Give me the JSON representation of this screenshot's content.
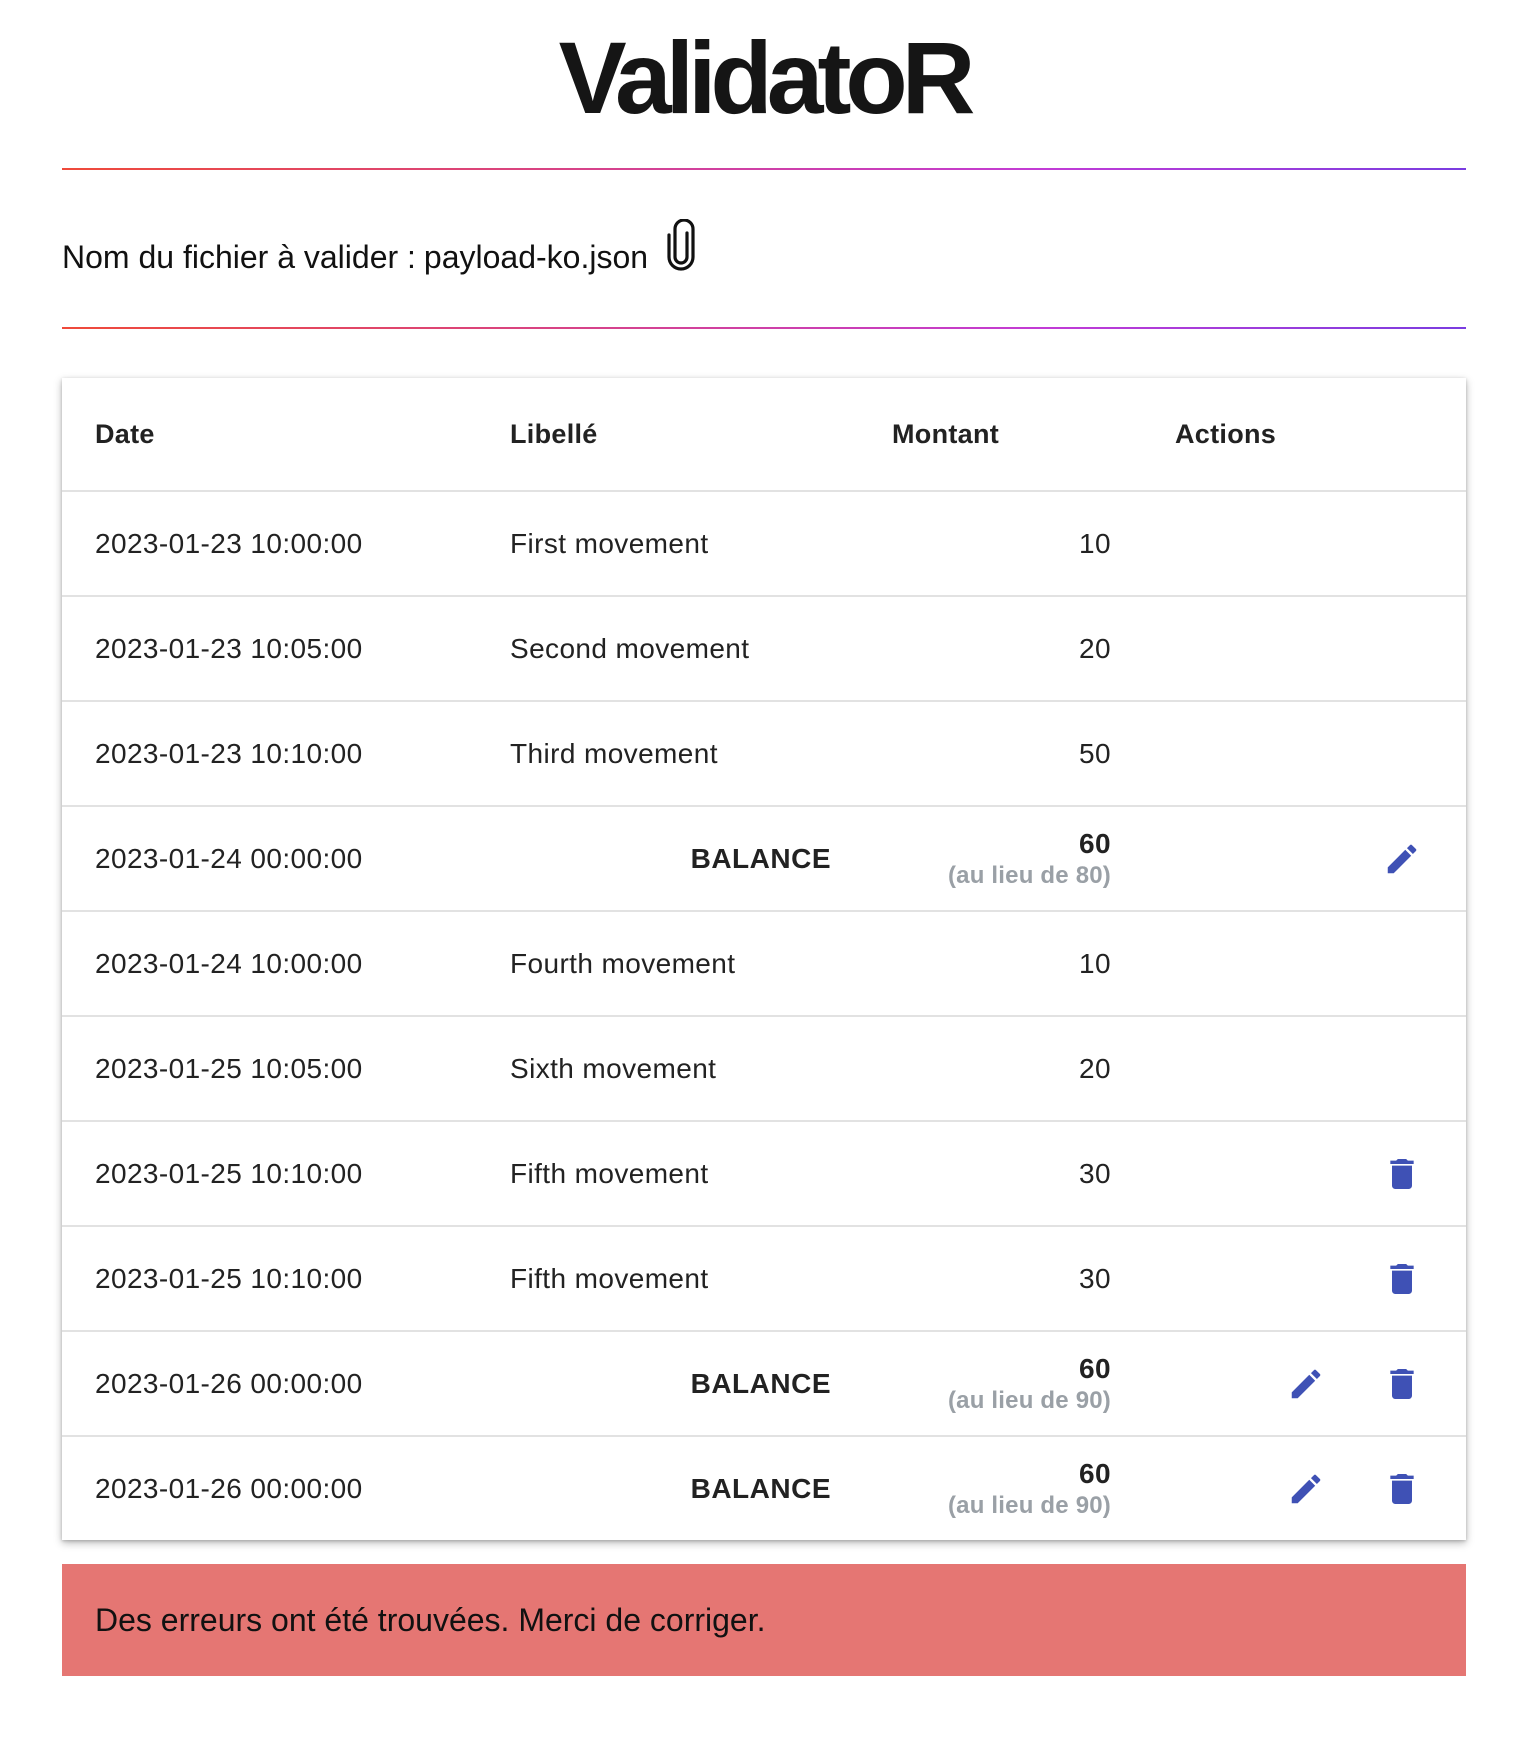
{
  "app": {
    "title": "ValidatoR"
  },
  "file": {
    "label": "Nom du fichier à valider :",
    "name": "payload-ko.json",
    "icon": "paperclip-icon"
  },
  "table": {
    "headers": {
      "date": "Date",
      "label": "Libellé",
      "amount": "Montant",
      "actions": "Actions"
    },
    "rows": [
      {
        "date": "2023-01-23 10:00:00",
        "label": "First movement",
        "amount": "10",
        "sub": "",
        "balance": false,
        "edit": false,
        "delete": false
      },
      {
        "date": "2023-01-23 10:05:00",
        "label": "Second movement",
        "amount": "20",
        "sub": "",
        "balance": false,
        "edit": false,
        "delete": false
      },
      {
        "date": "2023-01-23 10:10:00",
        "label": "Third movement",
        "amount": "50",
        "sub": "",
        "balance": false,
        "edit": false,
        "delete": false
      },
      {
        "date": "2023-01-24 00:00:00",
        "label": "BALANCE",
        "amount": "60",
        "sub": "(au lieu de 80)",
        "balance": true,
        "edit": true,
        "delete": false
      },
      {
        "date": "2023-01-24 10:00:00",
        "label": "Fourth movement",
        "amount": "10",
        "sub": "",
        "balance": false,
        "edit": false,
        "delete": false
      },
      {
        "date": "2023-01-25 10:05:00",
        "label": "Sixth movement",
        "amount": "20",
        "sub": "",
        "balance": false,
        "edit": false,
        "delete": false
      },
      {
        "date": "2023-01-25 10:10:00",
        "label": "Fifth movement",
        "amount": "30",
        "sub": "",
        "balance": false,
        "edit": false,
        "delete": true
      },
      {
        "date": "2023-01-25 10:10:00",
        "label": "Fifth movement",
        "amount": "30",
        "sub": "",
        "balance": false,
        "edit": false,
        "delete": true
      },
      {
        "date": "2023-01-26 00:00:00",
        "label": "BALANCE",
        "amount": "60",
        "sub": "(au lieu de 90)",
        "balance": true,
        "edit": true,
        "delete": true
      },
      {
        "date": "2023-01-26 00:00:00",
        "label": "BALANCE",
        "amount": "60",
        "sub": "(au lieu de 90)",
        "balance": true,
        "edit": true,
        "delete": true
      }
    ]
  },
  "alert": {
    "message": "Des erreurs ont été trouvées. Merci de corriger."
  },
  "colors": {
    "icon": "#3f51b5",
    "alert_bg": "#e57673",
    "sub_text": "#9aa0a6",
    "rule_start": "#ef4a3a",
    "rule_end": "#7a3ce0"
  },
  "icons": {
    "edit": "pencil-icon",
    "delete": "trash-icon"
  }
}
